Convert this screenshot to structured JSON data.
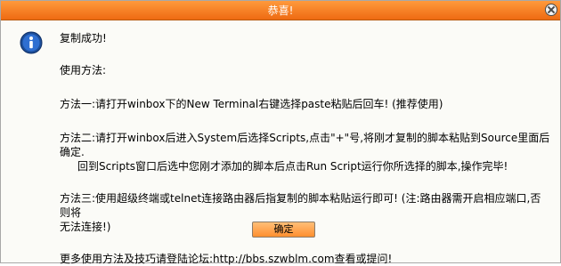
{
  "dialog": {
    "title": "恭喜!",
    "icon": "info-icon",
    "lines": {
      "success": "复制成功!",
      "usage_heading": "使用方法:",
      "method1": "方法一:请打开winbox下的New Terminal右键选择paste粘贴后回车! (推荐使用)",
      "method2_line1": "方法二:请打开winbox后进入System后选择Scripts,点击\"+\"号,将刚才复制的脚本粘贴到Source里面后确定.",
      "method2_line2": "回到Scripts窗口后选中您刚才添加的脚本后点击Run Script运行你所选择的脚本,操作完毕!",
      "method3_line1": "方法三:使用超级终端或telnet连接路由器后指复制的脚本粘贴运行即可! (注:路由器需开启相应端口,否则将",
      "method3_line2": "无法连接!)",
      "more": "更多使用方法及技巧请登陆论坛:http://bbs.szwblm.com查看或提问!"
    },
    "ok_label": "确定"
  }
}
